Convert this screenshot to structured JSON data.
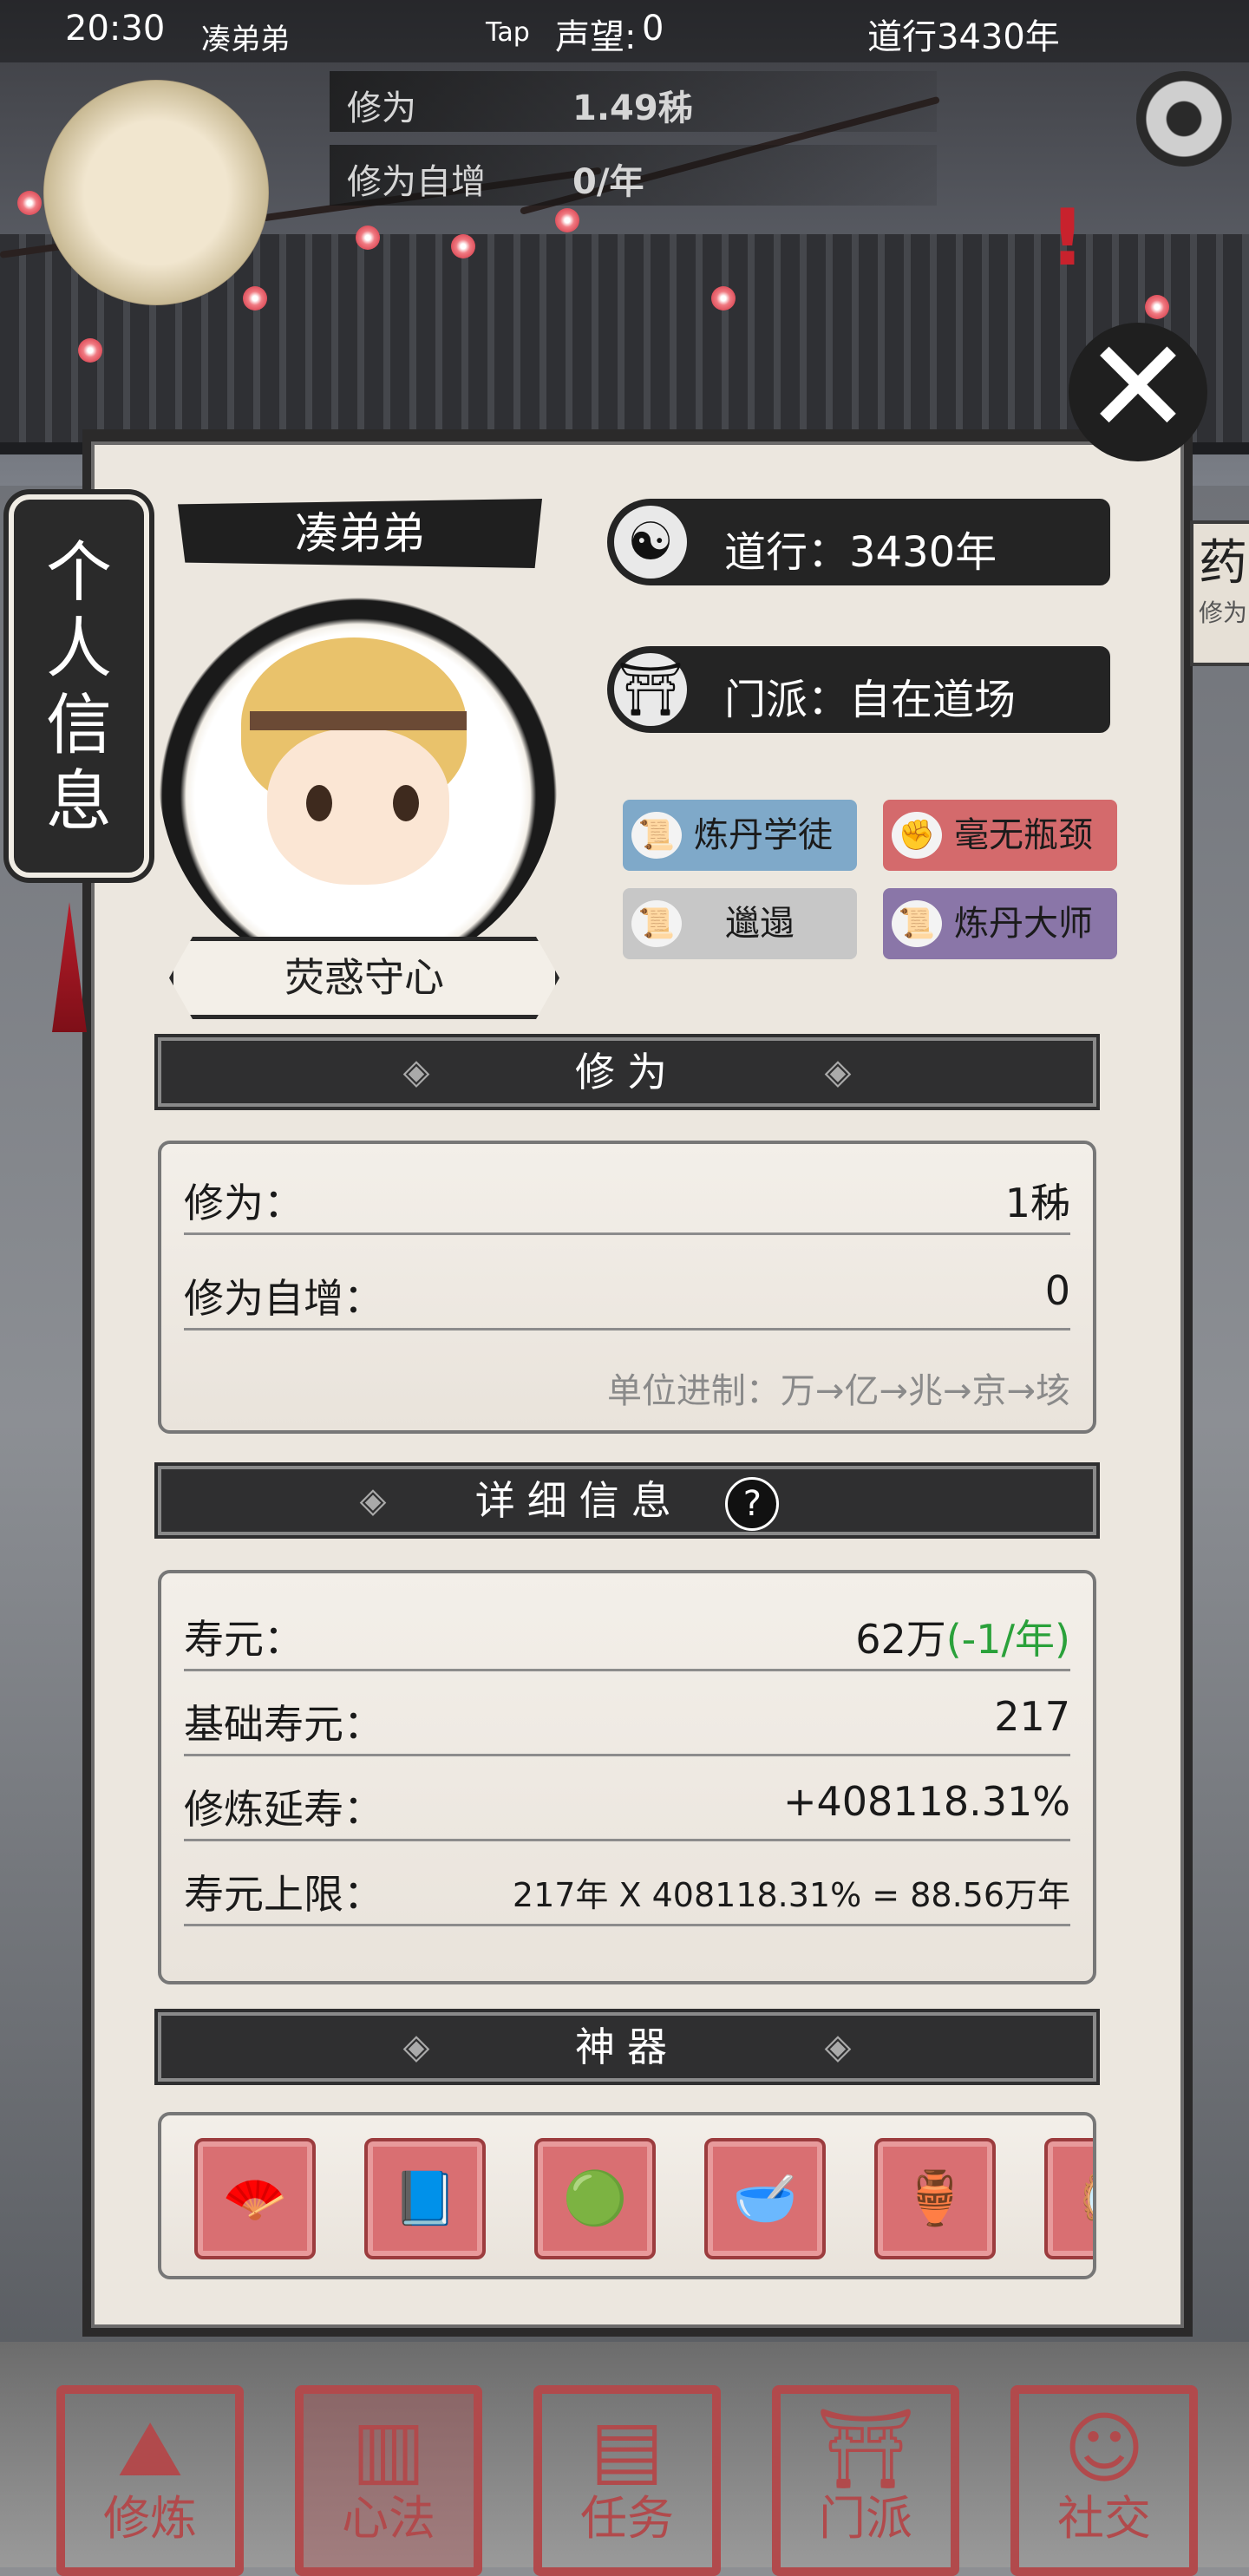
{
  "status_bar": {
    "time": "20:30",
    "app_label": "凑弟弟",
    "tap_label": "Tap"
  },
  "hud": {
    "reputation_label": "声望:",
    "reputation_value": "0",
    "daoxing_label": "道行",
    "daoxing_value": "3430年",
    "cultivation_label": "修为",
    "cultivation_value": "1.49秭",
    "auto_label": "修为自增",
    "auto_value": "0/年"
  },
  "profile": {
    "side_tab_label": "个人信息",
    "name": "凑弟弟",
    "title": "荧惑守心",
    "daoxing": "道行：3430年",
    "sect": "门派：自在道场",
    "tags": [
      "炼丹学徒",
      "毫无瓶颈",
      "邋遢",
      "炼丹大师"
    ],
    "right_hint_main": "药",
    "right_hint_sub": "修为"
  },
  "cultivation_section": {
    "header": "修为",
    "rows": [
      {
        "label": "修为：",
        "value": "1秭"
      },
      {
        "label": "修为自增：",
        "value": "0"
      }
    ],
    "unit_note": "单位进制：万→亿→兆→京→垓"
  },
  "detail_section": {
    "header": "详细信息",
    "help_icon": "?",
    "lifespan_label": "寿元：",
    "lifespan_value": "62万",
    "lifespan_delta": "(-1/年)",
    "base_label": "基础寿元：",
    "base_value": "217",
    "extend_label": "修炼延寿：",
    "extend_value": "+408118.31%",
    "limit_label": "寿元上限：",
    "limit_value": "217年 X 408118.31% = 88.56万年"
  },
  "artifact_section": {
    "header": "神器",
    "items": [
      "fan-icon",
      "book-icon",
      "mirror-icon",
      "bowl-icon",
      "jade-icon",
      "round-mirror-icon"
    ]
  },
  "bottom_nav": [
    {
      "label": "修炼",
      "icon": "mountain-icon"
    },
    {
      "label": "心法",
      "icon": "scroll-icon"
    },
    {
      "label": "任务",
      "icon": "scroll-task-icon"
    },
    {
      "label": "门派",
      "icon": "gate-icon"
    },
    {
      "label": "社交",
      "icon": "people-icon"
    }
  ],
  "colors": {
    "accent_red": "#b14a4c",
    "green": "#2aa13a",
    "panel_bg": "#ece7df"
  }
}
